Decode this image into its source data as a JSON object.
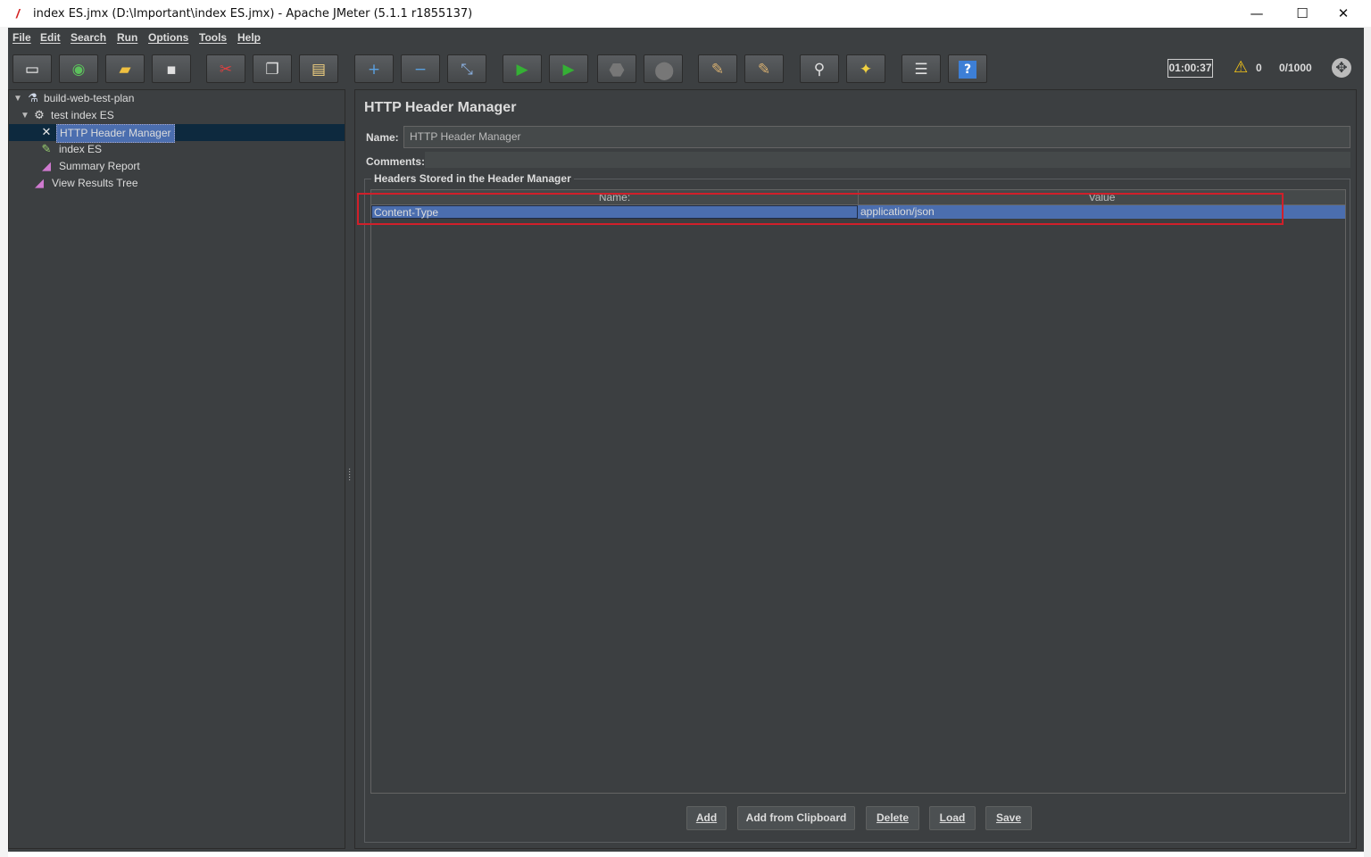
{
  "window": {
    "title": "index ES.jmx (D:\\Important\\index ES.jmx) - Apache JMeter (5.1.1 r1855137)",
    "controls": {
      "minimize": "—",
      "maximize": "☐",
      "close": "✕"
    }
  },
  "menu": [
    "File",
    "Edit",
    "Search",
    "Run",
    "Options",
    "Tools",
    "Help"
  ],
  "toolbar": {
    "buttons": [
      {
        "name": "new-icon",
        "glyph": "▭",
        "color": "#ffffff"
      },
      {
        "name": "templates-icon",
        "glyph": "◉",
        "color": "#5cc05c"
      },
      {
        "name": "open-icon",
        "glyph": "▰",
        "color": "#f0c040"
      },
      {
        "name": "save-icon",
        "glyph": "▪",
        "color": "#e0e0e0"
      },
      {
        "name": "cut-icon",
        "glyph": "✂",
        "color": "#e04040"
      },
      {
        "name": "copy-icon",
        "glyph": "❐",
        "color": "#e0e0e0"
      },
      {
        "name": "paste-icon",
        "glyph": "▤",
        "color": "#f0d080"
      },
      {
        "name": "expand-icon",
        "glyph": "+",
        "color": "#5aa0e0"
      },
      {
        "name": "collapse-icon",
        "glyph": "−",
        "color": "#5aa0e0"
      },
      {
        "name": "toggle-icon",
        "glyph": "⤡",
        "color": "#8ab0e0"
      },
      {
        "name": "start-icon",
        "glyph": "▶",
        "color": "#35b035"
      },
      {
        "name": "start-no-pause-icon",
        "glyph": "▶",
        "color": "#35b035"
      },
      {
        "name": "stop-icon",
        "glyph": "⬣",
        "color": "#777777"
      },
      {
        "name": "shutdown-icon",
        "glyph": "⬤",
        "color": "#777777"
      },
      {
        "name": "clear-icon",
        "glyph": "✎",
        "color": "#d8b070"
      },
      {
        "name": "clear-all-icon",
        "glyph": "✎",
        "color": "#d8b070"
      },
      {
        "name": "search-icon",
        "glyph": "⚲",
        "color": "#e0e0e0"
      },
      {
        "name": "reset-search-icon",
        "glyph": "✦",
        "color": "#f0d040"
      },
      {
        "name": "function-helper-icon",
        "glyph": "☰",
        "color": "#e0e0e0"
      },
      {
        "name": "help-icon",
        "glyph": "?",
        "color": "#ffffff"
      }
    ],
    "timer": "01:00:37",
    "warning_count": "0",
    "threads": "0/1000"
  },
  "tree": {
    "items": [
      {
        "label": "build-web-test-plan",
        "icon": "flask-icon"
      },
      {
        "label": "test index ES",
        "icon": "gear-icon"
      },
      {
        "label": "HTTP Header Manager",
        "icon": "wrench-icon"
      },
      {
        "label": "index ES",
        "icon": "pencil-icon"
      },
      {
        "label": "Summary Report",
        "icon": "chart-icon"
      },
      {
        "label": "View Results Tree",
        "icon": "chart-icon"
      }
    ]
  },
  "panel": {
    "title": "HTTP Header Manager",
    "name_label": "Name:",
    "name_value": "HTTP Header Manager",
    "comments_label": "Comments:",
    "group_title": "Headers Stored in the Header Manager",
    "table": {
      "columns": [
        "Name:",
        "Value"
      ],
      "rows": [
        {
          "name": "Content-Type",
          "value": "application/json"
        }
      ]
    },
    "buttons": {
      "add": "Add",
      "add_from_clipboard": "Add from Clipboard",
      "delete": "Delete",
      "load": "Load",
      "save": "Save"
    }
  },
  "annotation": {
    "color": "#d11f2a"
  }
}
